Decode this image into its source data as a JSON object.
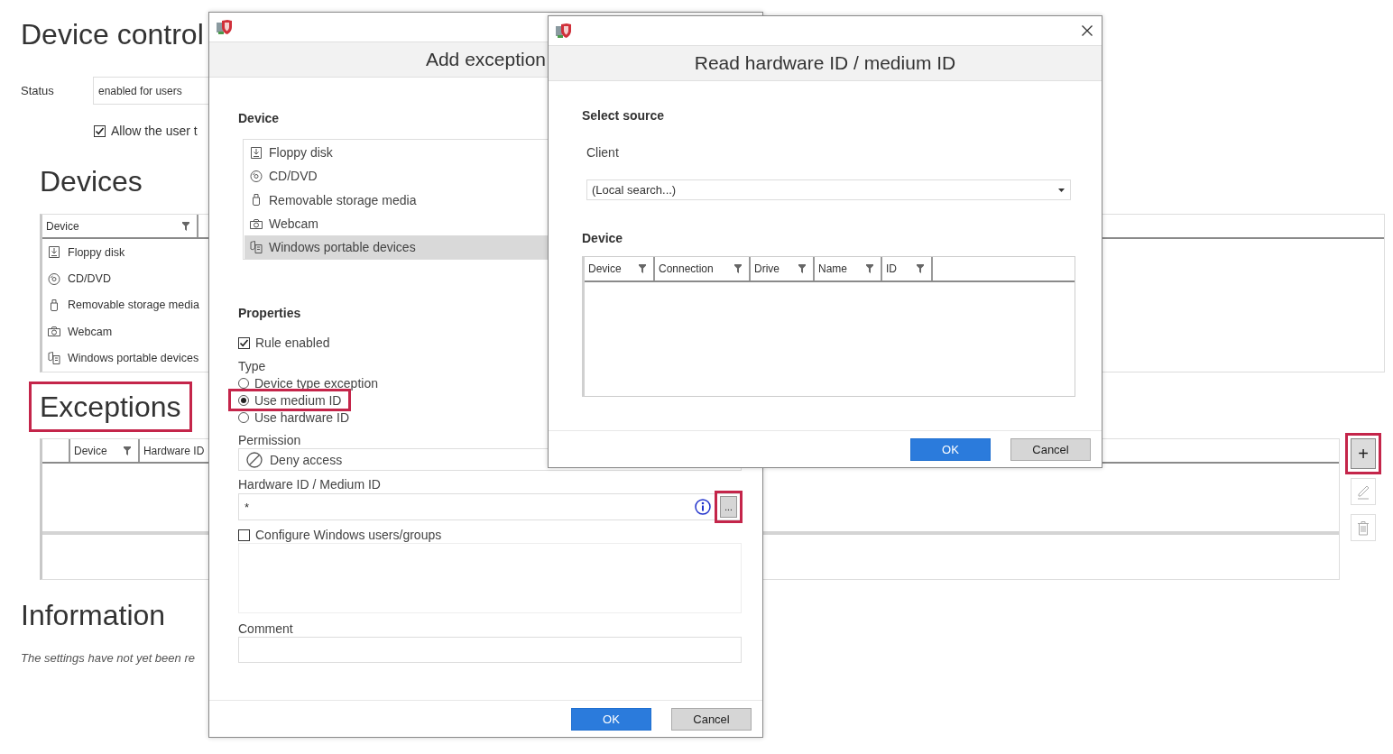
{
  "background": {
    "title": "Device control",
    "status": {
      "label": "Status",
      "value": "enabled for users"
    },
    "allow_user": {
      "label": "Allow the user t",
      "checked": true
    },
    "devices": {
      "heading": "Devices",
      "columns": [
        {
          "label": "Device",
          "filter": true
        }
      ],
      "rows": [
        {
          "kind": "floppy",
          "label": "Floppy disk"
        },
        {
          "kind": "disc",
          "label": "CD/DVD"
        },
        {
          "kind": "usb",
          "label": "Removable storage media"
        },
        {
          "kind": "webcam",
          "label": "Webcam"
        },
        {
          "kind": "portable",
          "label": "Windows portable devices"
        }
      ]
    },
    "exceptions": {
      "heading": "Exceptions",
      "highlighted": true,
      "columns": [
        {
          "label": "Device",
          "filter": true
        },
        {
          "label": "Hardware ID",
          "filter": false
        }
      ],
      "tools": [
        {
          "kind": "add",
          "label": "+",
          "disabled": false,
          "highlighted": true
        },
        {
          "kind": "edit",
          "disabled": true,
          "highlighted": false
        },
        {
          "kind": "delete",
          "disabled": true,
          "highlighted": false
        }
      ]
    },
    "information": {
      "heading": "Information",
      "note": "The settings have not yet been re"
    }
  },
  "add_exception": {
    "title": "Add exception",
    "device_label": "Device",
    "devices": [
      {
        "kind": "floppy",
        "label": "Floppy disk",
        "selected": false
      },
      {
        "kind": "disc",
        "label": "CD/DVD",
        "selected": false
      },
      {
        "kind": "usb",
        "label": "Removable storage media",
        "selected": false
      },
      {
        "kind": "webcam",
        "label": "Webcam",
        "selected": false
      },
      {
        "kind": "portable",
        "label": "Windows portable devices",
        "selected": true
      }
    ],
    "properties_label": "Properties",
    "rule_enabled": {
      "label": "Rule enabled",
      "checked": true
    },
    "type_label": "Type",
    "types": [
      {
        "label": "Device type exception",
        "selected": false,
        "highlighted": false
      },
      {
        "label": "Use medium ID",
        "selected": true,
        "highlighted": true
      },
      {
        "label": "Use hardware ID",
        "selected": false,
        "highlighted": false
      }
    ],
    "permission_label": "Permission",
    "permission": "Deny access",
    "id_label": "Hardware ID / Medium ID",
    "id_value": "*",
    "browse_button": {
      "label": "...",
      "highlighted": true
    },
    "configure_users": {
      "label": "Configure Windows users/groups",
      "checked": false
    },
    "comment_label": "Comment",
    "buttons": [
      "OK",
      "Cancel"
    ]
  },
  "read_id": {
    "title": "Read hardware ID / medium ID",
    "source_label": "Select source",
    "client_label": "Client",
    "client_value": "(Local search...)",
    "device_label": "Device",
    "columns": [
      "Device",
      "Connection",
      "Drive",
      "Name",
      "ID"
    ],
    "buttons": [
      "OK",
      "Cancel"
    ]
  }
}
